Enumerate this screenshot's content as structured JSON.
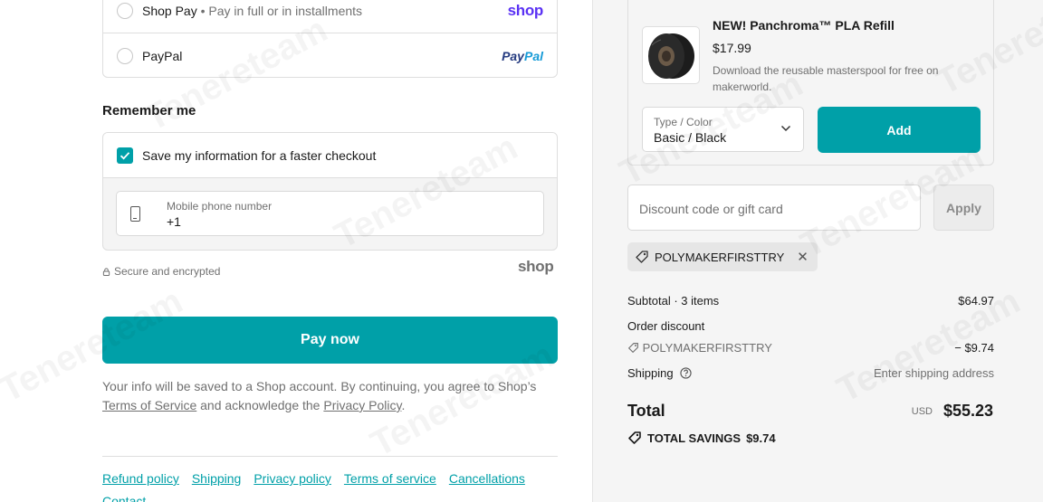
{
  "payment": {
    "shop_pay_label": "Shop Pay",
    "shop_pay_sub": "• Pay in full or in installments",
    "shop_pay_logo": "shop",
    "paypal_label": "PayPal",
    "paypal_logo_a": "Pay",
    "paypal_logo_b": "Pal"
  },
  "remember": {
    "title": "Remember me",
    "save_label": "Save my information for a faster checkout",
    "phone_label": "Mobile phone number",
    "phone_value": "+1",
    "secure_text": "Secure and encrypted",
    "shop_mark": "shop"
  },
  "pay_now_label": "Pay now",
  "legal": {
    "text_1": "Your info will be saved to a Shop account. By continuing, you agree to Shop’s",
    "terms_link": "Terms of Service",
    "text_2": " and acknowledge the ",
    "privacy_link": "Privacy Policy",
    "text_3": "."
  },
  "footer": {
    "links": [
      "Refund policy",
      "Shipping",
      "Privacy policy",
      "Terms of service",
      "Cancellations"
    ],
    "contact": "Contact"
  },
  "upsell": {
    "name": "NEW! Panchroma™ PLA Refill",
    "price": "$17.99",
    "description": "Download the reusable masterspool for free on makerworld.",
    "variant_label": "Type / Color",
    "variant_value": "Basic / Black",
    "add_label": "Add"
  },
  "discount": {
    "placeholder": "Discount code or gift card",
    "apply_label": "Apply",
    "code": "POLYMAKERFIRSTTRY"
  },
  "summary": {
    "subtotal_label": "Subtotal · 3 items",
    "subtotal_value": "$64.97",
    "order_discount_label": "Order discount",
    "discount_code": "POLYMAKERFIRSTTRY",
    "discount_value": "− $9.74",
    "shipping_label": "Shipping",
    "shipping_value": "Enter shipping address",
    "total_label": "Total",
    "currency": "USD",
    "total_value": "$55.23",
    "savings_label": "TOTAL SAVINGS",
    "savings_value": "$9.74"
  },
  "watermark": "Tenereteam",
  "colors": {
    "accent": "#00a0a8",
    "shop_purple": "#5a31f4",
    "muted": "#707070"
  }
}
